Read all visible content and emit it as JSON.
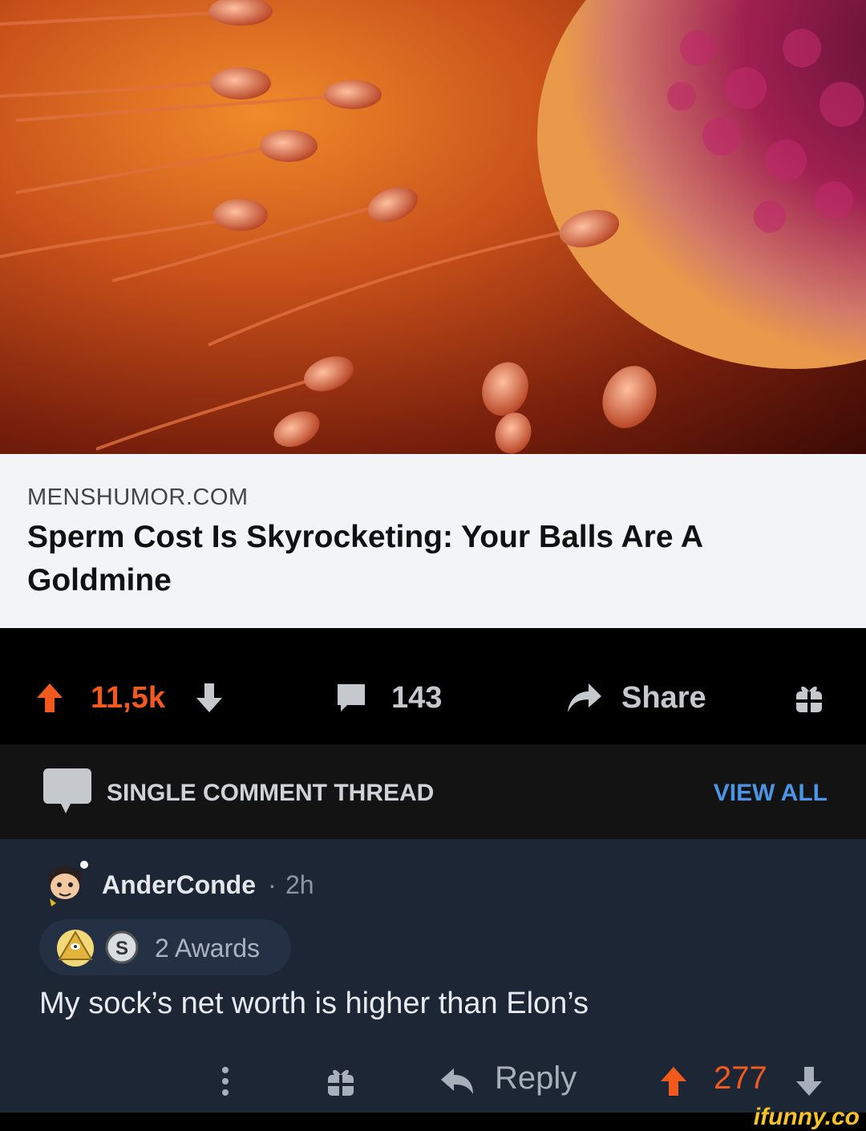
{
  "colors": {
    "upvote": "#f25a1d",
    "accent_blue": "#4a95e6",
    "icon_gray": "#c5c9ce",
    "comment_bg": "#1c2634",
    "watermark": "#f7c325"
  },
  "link_card": {
    "domain": "MENSHUMOR.COM",
    "headline": "Sperm Cost Is Skyrocketing: Your Balls Are A Goldmine"
  },
  "actions": {
    "score": "11,5k",
    "comments": "143",
    "share": "Share",
    "icons": [
      "upvote-arrow-icon",
      "downvote-arrow-icon",
      "comment-bubble-icon",
      "share-arrow-icon",
      "gift-icon"
    ]
  },
  "thread": {
    "title": "SINGLE COMMENT THREAD",
    "view_all": "VIEW ALL"
  },
  "comment": {
    "username": "AnderConde",
    "separator": "·",
    "age": "2h",
    "awards": "2 Awards",
    "award_letter": "S",
    "body": "My sock’s net worth is higher than Elon’s",
    "reply": "Reply",
    "score": "277"
  },
  "watermark": "ifunny.co"
}
